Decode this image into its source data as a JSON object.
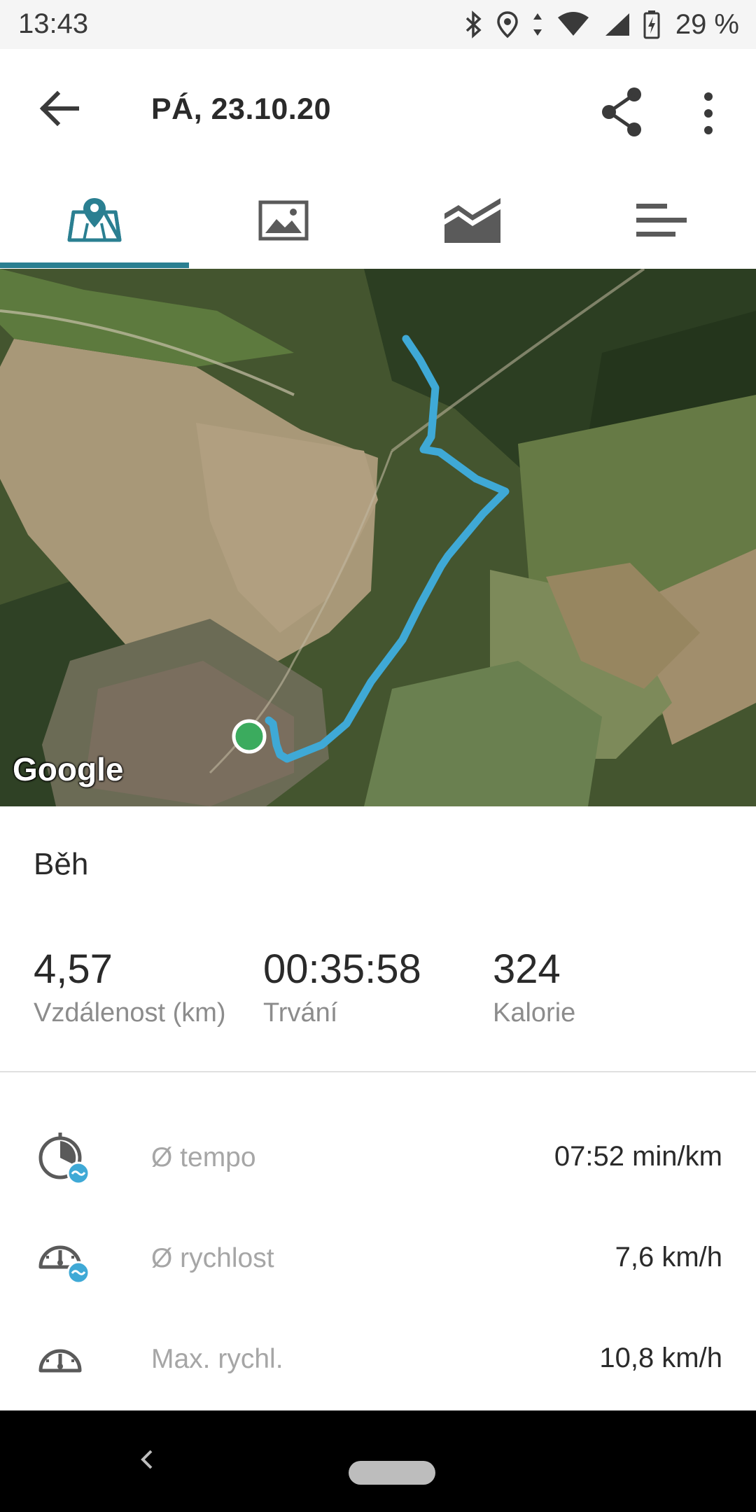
{
  "status_bar": {
    "time": "13:43",
    "battery": "29 %",
    "icons": [
      "bluetooth-icon",
      "location-icon",
      "wifi-icon",
      "signal-icon",
      "battery-charging-icon"
    ]
  },
  "header": {
    "title": "PÁ, 23.10.20",
    "back_icon": "arrow-back-icon",
    "share_icon": "share-icon",
    "more_icon": "more-vert-icon"
  },
  "tabs": [
    {
      "icon": "map-icon",
      "active": true
    },
    {
      "icon": "photo-icon",
      "active": false
    },
    {
      "icon": "chart-icon",
      "active": false
    },
    {
      "icon": "laps-icon",
      "active": false
    }
  ],
  "map": {
    "attribution": "Google",
    "route_color": "#3fa9d6",
    "start_marker_color": "#3bab5e"
  },
  "summary": {
    "activity_type": "Běh",
    "stats": [
      {
        "value": "4,57",
        "label": "Vzdálenost (km)"
      },
      {
        "value": "00:35:58",
        "label": "Trvání"
      },
      {
        "value": "324",
        "label": "Kalorie"
      }
    ]
  },
  "metrics": [
    {
      "icon": "pace-icon",
      "label": "Ø tempo",
      "value": "07:52 min/km"
    },
    {
      "icon": "avg-speed-icon",
      "label": "Ø rychlost",
      "value": "7,6 km/h"
    },
    {
      "icon": "max-speed-icon",
      "label": "Max. rychl.",
      "value": "10,8 km/h"
    }
  ],
  "colors": {
    "accent": "#2a7f91",
    "label_gray": "#8c8c8c"
  }
}
